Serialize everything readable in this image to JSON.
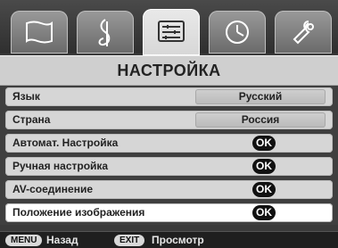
{
  "menu": {
    "title": "НАСТРОЙКА",
    "tabs": [
      {
        "name": "picture-icon"
      },
      {
        "name": "sound-icon"
      },
      {
        "name": "setup-icon"
      },
      {
        "name": "timer-icon"
      },
      {
        "name": "wrench-icon"
      }
    ],
    "rows": [
      {
        "label": "Язык",
        "value": "Русский"
      },
      {
        "label": "Страна",
        "value": "Россия"
      },
      {
        "label": "Автомат. Настройка",
        "badge": "OK"
      },
      {
        "label": "Ручная настройка",
        "badge": "OK"
      },
      {
        "label": "AV-соединение",
        "badge": "OK"
      },
      {
        "label": "Положение изображения",
        "badge": "OK"
      }
    ]
  },
  "footer": {
    "menu_key": "MENU",
    "menu_hint": "Назад",
    "exit_key": "EXIT",
    "exit_hint": "Просмотр"
  }
}
